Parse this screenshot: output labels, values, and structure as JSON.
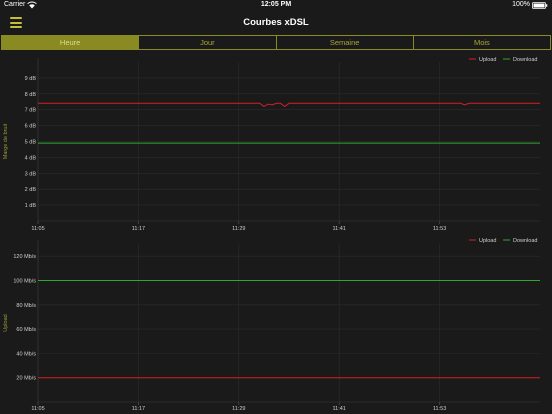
{
  "status": {
    "carrier": "Carrier",
    "time": "12:05 PM",
    "battery": "100%"
  },
  "nav": {
    "title": "Courbes xDSL"
  },
  "tabs": [
    {
      "label": "Heure",
      "active": true
    },
    {
      "label": "Jour",
      "active": false
    },
    {
      "label": "Semaine",
      "active": false
    },
    {
      "label": "Mois",
      "active": false
    }
  ],
  "colors": {
    "accent": "#8a8a22",
    "upload": "#d42020",
    "download": "#2fa82f",
    "grid": "#2c2c2c"
  },
  "icons": [
    "menu-icon",
    "wifi-icon",
    "battery-icon"
  ],
  "chart_data": [
    {
      "type": "line",
      "ylabel": "Marge de bruit",
      "unit": " dB",
      "yticks": [
        1,
        2,
        3,
        4,
        5,
        6,
        7,
        8,
        9
      ],
      "ylim": [
        0,
        10
      ],
      "xtick_labels": [
        "11:05",
        "11:17",
        "11:29",
        "11:41",
        "11:53"
      ],
      "xlim": [
        0,
        60
      ],
      "legend": [
        "Upload",
        "Download"
      ],
      "legend_position": "top-right",
      "grid": true,
      "series": [
        {
          "name": "Upload",
          "color": "#d42020",
          "points": [
            [
              0,
              7.4
            ],
            [
              26.5,
              7.4
            ],
            [
              27,
              7.2
            ],
            [
              27.5,
              7.35
            ],
            [
              28,
              7.3
            ],
            [
              28.5,
              7.4
            ],
            [
              29,
              7.4
            ],
            [
              29.5,
              7.2
            ],
            [
              30,
              7.4
            ],
            [
              50.5,
              7.4
            ],
            [
              51,
              7.3
            ],
            [
              51.5,
              7.4
            ],
            [
              60,
              7.4
            ]
          ]
        },
        {
          "name": "Download",
          "color": "#2fa82f",
          "points": [
            [
              0,
              4.9
            ],
            [
              60,
              4.9
            ]
          ]
        }
      ]
    },
    {
      "type": "line",
      "ylabel": "Upload",
      "unit": " Mb/s",
      "yticks": [
        20,
        40,
        60,
        80,
        100,
        120
      ],
      "ylim": [
        0,
        130
      ],
      "xtick_labels": [
        "11:05",
        "11:17",
        "11:29",
        "11:41",
        "11:53"
      ],
      "xlim": [
        0,
        60
      ],
      "legend": [
        "Upload",
        "Download"
      ],
      "legend_position": "top-right",
      "grid": true,
      "series": [
        {
          "name": "Upload",
          "color": "#d42020",
          "points": [
            [
              0,
              20
            ],
            [
              60,
              20
            ]
          ]
        },
        {
          "name": "Download",
          "color": "#2fa82f",
          "points": [
            [
              0,
              100
            ],
            [
              60,
              100
            ]
          ]
        }
      ]
    }
  ]
}
